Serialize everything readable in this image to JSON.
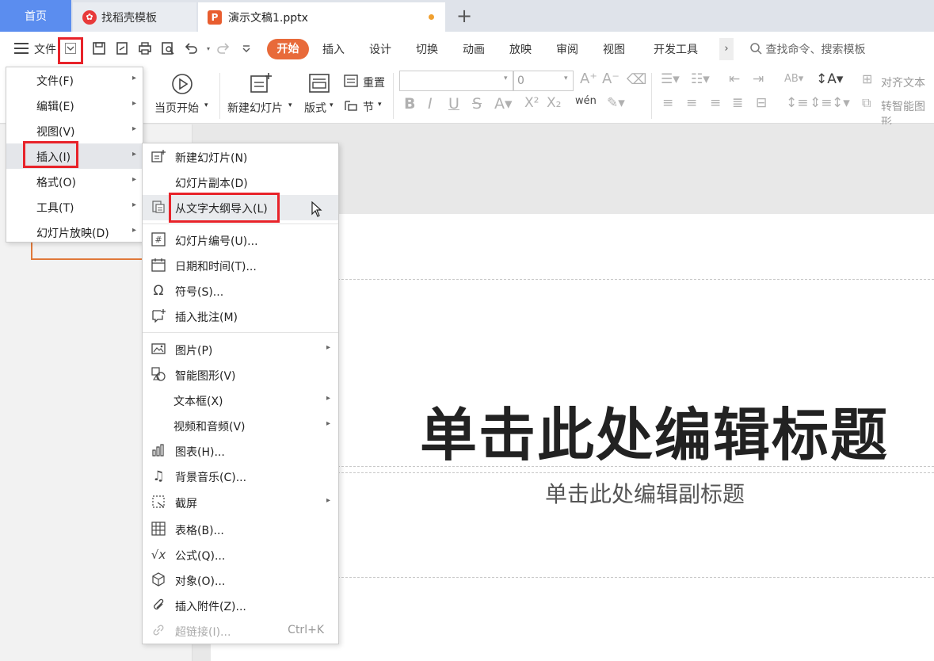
{
  "tabs": {
    "home": "首页",
    "docer": "找稻壳模板",
    "doc": "演示文稿1.pptx",
    "add": "+"
  },
  "menubar": {
    "file": "文件",
    "tabs": [
      "开始",
      "插入",
      "设计",
      "切换",
      "动画",
      "放映",
      "审阅",
      "视图",
      "开发工具"
    ],
    "search_placeholder": "查找命令、搜索模板"
  },
  "ribbon": {
    "page_start": "当页开始",
    "new_slide": "新建幻灯片",
    "layout": "版式",
    "section": "节",
    "reset": "重置",
    "font_size": "0",
    "align_text": "对齐文本",
    "smart_shape": "转智能图形"
  },
  "menu1": {
    "items": [
      {
        "label": "文件(F)"
      },
      {
        "label": "编辑(E)"
      },
      {
        "label": "视图(V)"
      },
      {
        "label": "插入(I)"
      },
      {
        "label": "格式(O)"
      },
      {
        "label": "工具(T)"
      },
      {
        "label": "幻灯片放映(D)"
      }
    ]
  },
  "menu2": {
    "items": [
      {
        "label": "新建幻灯片(N)"
      },
      {
        "label": "幻灯片副本(D)"
      },
      {
        "label": "从文字大纲导入(L)"
      },
      {
        "label": "幻灯片编号(U)..."
      },
      {
        "label": "日期和时间(T)..."
      },
      {
        "label": "符号(S)..."
      },
      {
        "label": "插入批注(M)"
      },
      {
        "label": "图片(P)"
      },
      {
        "label": "智能图形(V)"
      },
      {
        "label": "文本框(X)"
      },
      {
        "label": "视频和音频(V)"
      },
      {
        "label": "图表(H)..."
      },
      {
        "label": "背景音乐(C)..."
      },
      {
        "label": "截屏"
      },
      {
        "label": "表格(B)..."
      },
      {
        "label": "公式(Q)..."
      },
      {
        "label": "对象(O)..."
      },
      {
        "label": "插入附件(Z)..."
      },
      {
        "label": "超链接(I)...",
        "shortcut": "Ctrl+K"
      }
    ]
  },
  "slide": {
    "title": "单击此处编辑标题",
    "subtitle": "单击此处编辑副标题"
  },
  "colors": {
    "accent": "#e86a3a",
    "home_tab": "#5b8def",
    "highlight_box": "#e8232a"
  }
}
